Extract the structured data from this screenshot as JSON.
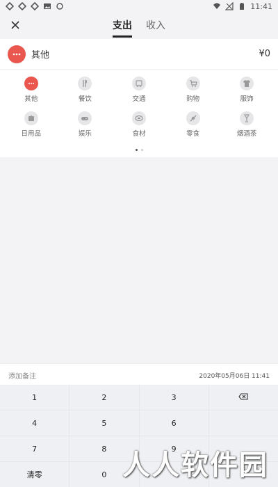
{
  "status": {
    "time": "11:41"
  },
  "tabs": [
    {
      "label": "支出"
    },
    {
      "label": "收入"
    }
  ],
  "selected": {
    "name": "其他",
    "amount": "¥0"
  },
  "categories": [
    {
      "label": "其他",
      "icon": "more-icon"
    },
    {
      "label": "餐饮",
      "icon": "dining-icon"
    },
    {
      "label": "交通",
      "icon": "bus-icon"
    },
    {
      "label": "购物",
      "icon": "cart-icon"
    },
    {
      "label": "服饰",
      "icon": "shirt-icon"
    },
    {
      "label": "日用品",
      "icon": "tissue-icon"
    },
    {
      "label": "娱乐",
      "icon": "gamepad-icon"
    },
    {
      "label": "食材",
      "icon": "food-icon"
    },
    {
      "label": "零食",
      "icon": "candy-icon"
    },
    {
      "label": "烟酒茶",
      "icon": "drink-icon"
    }
  ],
  "note": {
    "placeholder": "添加备注",
    "date": "2020年05月06日 11:41"
  },
  "keys": [
    "1",
    "2",
    "3",
    "",
    "4",
    "5",
    "6",
    "",
    "7",
    "8",
    "9",
    "",
    "清零",
    "0",
    "",
    ""
  ],
  "watermark": "人人软件园",
  "colors": {
    "accent": "#e9574f"
  }
}
